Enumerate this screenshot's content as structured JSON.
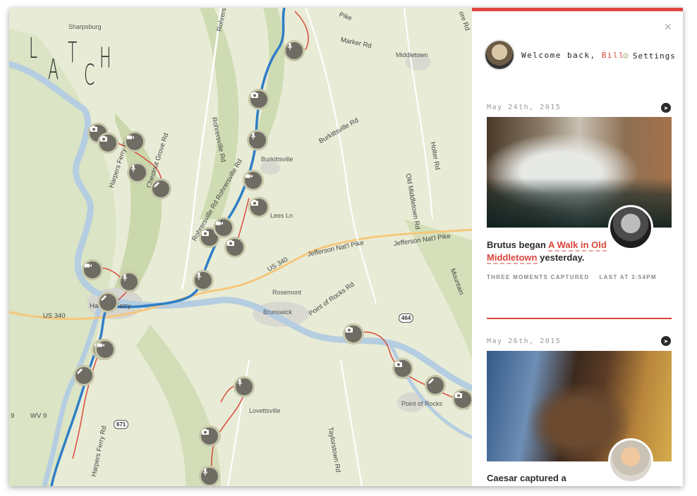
{
  "app": {
    "logo_letters": [
      "L",
      "A",
      "T",
      "C",
      "H"
    ]
  },
  "map": {
    "place_labels": [
      "Sharpsburg",
      "Middletown",
      "Burkittsville",
      "Lees Ln",
      "Rosemont",
      "Brunswick",
      "Lovettsville",
      "Point of Rocks"
    ],
    "road_labels": [
      "Rohrersville Rd",
      "Rohrersville Rd",
      "Rohrersville Rd Rohrersville Rd",
      "Marker Rd",
      "Burkittsville Rd",
      "Old Middletown Rd",
      "Holter Rd",
      "Harpers Ferry Rd",
      "Chestnut Grove Rd",
      "Jefferson Nat'l Pike",
      "Jefferson Nat'l Pike",
      "US 340",
      "US 340",
      "Point of Rocks Rd",
      "Harpers Ferry Rd",
      "Taylorstown Rd",
      "WV 9",
      "9",
      "Mountain",
      "Harpers Ferry",
      "Pike",
      "ore Rd"
    ],
    "shields": [
      "464",
      "671"
    ],
    "markers": [
      "mic",
      "camera",
      "camera",
      "camera",
      "video",
      "video",
      "mic",
      "pencil",
      "mic",
      "video",
      "camera",
      "video",
      "camera",
      "camera",
      "camera",
      "mic",
      "video",
      "mic",
      "pencil",
      "camera",
      "video",
      "pencil",
      "camera",
      "camera",
      "pencil",
      "camera",
      "mic",
      "camera",
      "mic"
    ]
  },
  "panel": {
    "close_icon": "×",
    "welcome_prefix": "Welcome back,",
    "user_name": "Bill",
    "settings_label": "Settings",
    "accent_color": "#e0473d",
    "stories": [
      {
        "date": "May 24th, 2015",
        "author": "Brutus began",
        "walk_link": "A Walk in Old Middletown",
        "suffix": "yesterday.",
        "moments": "THREE MOMENTS CAPTURED",
        "last_at": "LAST AT 3:54PM"
      },
      {
        "date": "May 26th, 2015",
        "author": "Caesar captured a"
      }
    ]
  }
}
